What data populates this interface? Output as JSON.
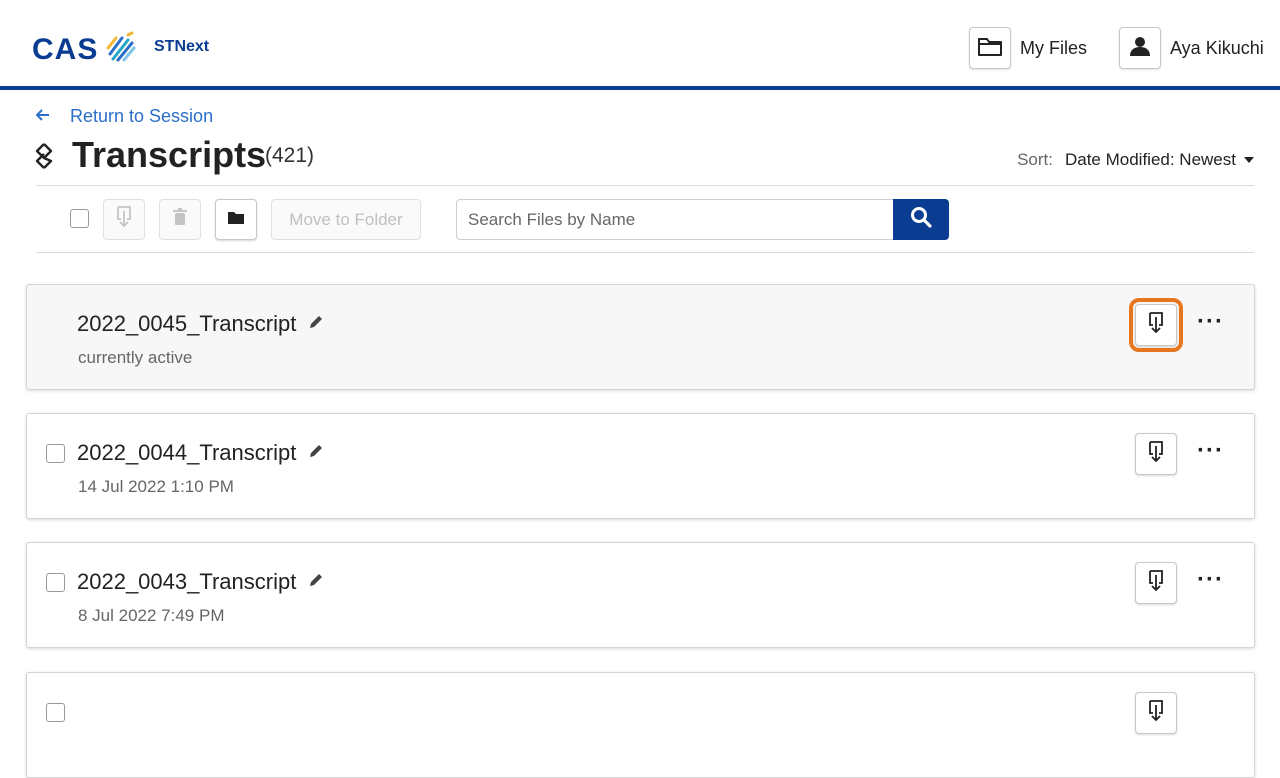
{
  "header": {
    "logo_text": "CAS",
    "product_name": "STNext",
    "my_files_label": "My Files",
    "user_name": "Aya Kikuchi"
  },
  "nav": {
    "back_label": "Return to Session"
  },
  "page": {
    "title": "Transcripts",
    "count": "(421)"
  },
  "sort": {
    "label": "Sort:",
    "value": "Date Modified: Newest"
  },
  "toolbar": {
    "move_label": "Move to Folder",
    "search_placeholder": "Search Files by Name"
  },
  "files": [
    {
      "name": "2022_0045_Transcript",
      "subtitle": "currently active"
    },
    {
      "name": "2022_0044_Transcript",
      "subtitle": "14 Jul 2022 1:10 PM"
    },
    {
      "name": "2022_0043_Transcript",
      "subtitle": "8 Jul 2022 7:49 PM"
    }
  ],
  "colors": {
    "brand": "#0a3d91",
    "link": "#2a6fc9",
    "highlight": "#e8761f"
  }
}
